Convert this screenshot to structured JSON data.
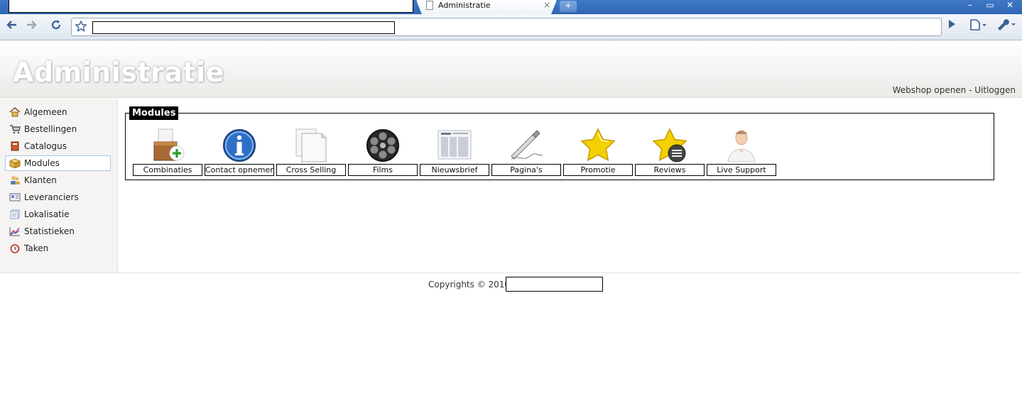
{
  "browser": {
    "tab_title": "Administratie",
    "tab_close": "×",
    "new_tab": "+",
    "window_buttons": [
      "–",
      "▭",
      "✕"
    ]
  },
  "header": {
    "brand": "Administratie",
    "webshop_link": "Webshop openen",
    "separator": " - ",
    "logout_link": "Uitloggen"
  },
  "sidebar": {
    "items": [
      {
        "label": "Algemeen",
        "icon": "home-icon",
        "active": false
      },
      {
        "label": "Bestellingen",
        "icon": "cart-icon",
        "active": false
      },
      {
        "label": "Catalogus",
        "icon": "book-icon",
        "active": false
      },
      {
        "label": "Modules",
        "icon": "box-icon",
        "active": true
      },
      {
        "label": "Klanten",
        "icon": "users-icon",
        "active": false
      },
      {
        "label": "Leveranciers",
        "icon": "card-icon",
        "active": false
      },
      {
        "label": "Lokalisatie",
        "icon": "pages-icon",
        "active": false
      },
      {
        "label": "Statistieken",
        "icon": "chart-icon",
        "active": false
      },
      {
        "label": "Taken",
        "icon": "alarm-clock-icon",
        "active": false
      }
    ]
  },
  "modules": {
    "legend": "Modules",
    "items": [
      {
        "label": "Combinaties",
        "icon": "box-add-icon"
      },
      {
        "label": "Contact opnemen",
        "icon": "info-icon"
      },
      {
        "label": "Cross Selling",
        "icon": "documents-icon"
      },
      {
        "label": "Films",
        "icon": "film-reel-icon"
      },
      {
        "label": "Nieuwsbrief",
        "icon": "newspaper-icon"
      },
      {
        "label": "Pagina's",
        "icon": "pen-icon"
      },
      {
        "label": "Promotie",
        "icon": "star-icon"
      },
      {
        "label": "Reviews",
        "icon": "star-list-icon"
      },
      {
        "label": "Live Support",
        "icon": "person-icon"
      }
    ]
  },
  "footer": {
    "copyright": "Copyrights © 2010 ::"
  },
  "colors": {
    "legend_bg": "#000000",
    "active_border": "#a8c4e4",
    "star_yellow": "#f5d000"
  }
}
